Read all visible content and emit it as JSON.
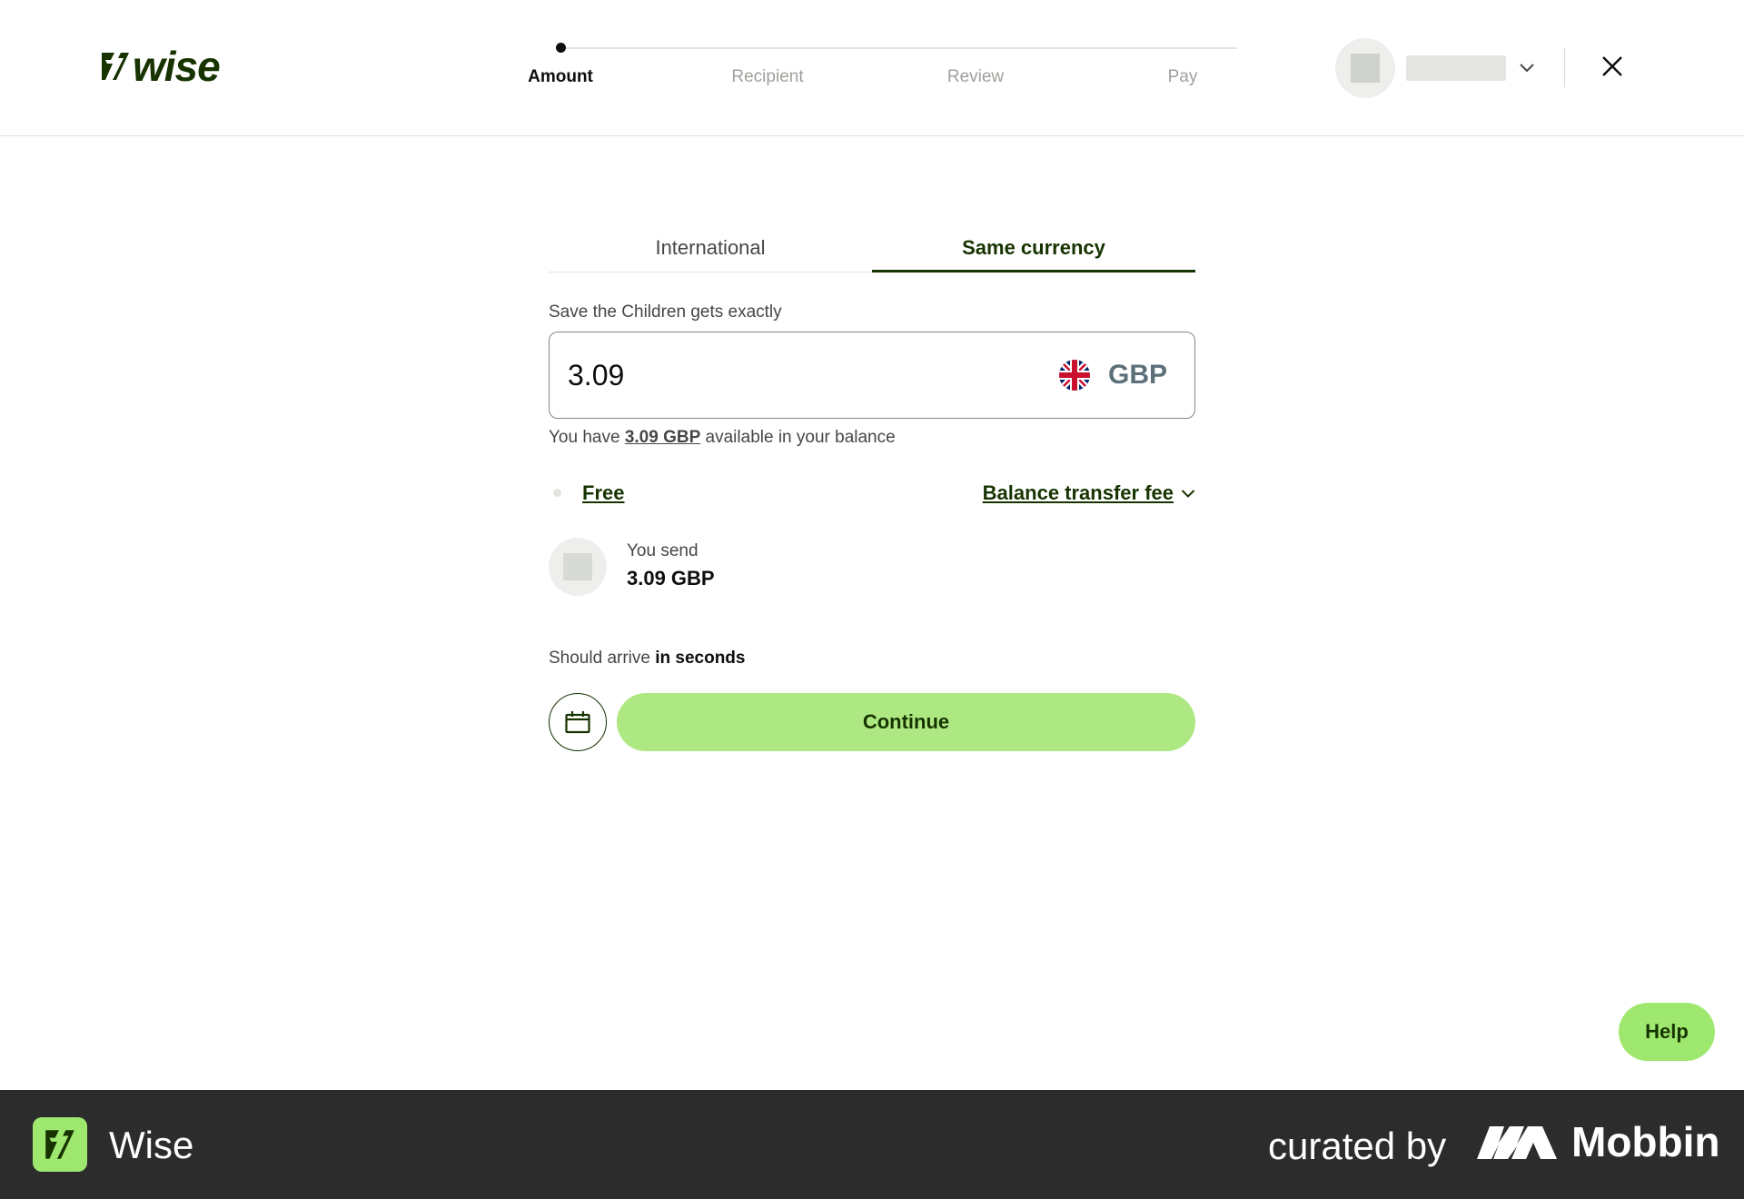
{
  "brand": {
    "name": "wise",
    "color": "#163300",
    "accent": "#9fe870"
  },
  "stepper": {
    "steps": [
      {
        "label": "Amount",
        "active": true
      },
      {
        "label": "Recipient",
        "active": false
      },
      {
        "label": "Review",
        "active": false
      },
      {
        "label": "Pay",
        "active": false
      }
    ]
  },
  "account": {
    "icon": "chevron-down-icon"
  },
  "header": {
    "close_icon": "close-icon"
  },
  "tabs": [
    {
      "label": "International",
      "selected": false
    },
    {
      "label": "Same currency",
      "selected": true
    }
  ],
  "amount": {
    "label": "Save the Children gets exactly",
    "value": "3.09",
    "currency": "GBP",
    "flag_icon": "uk-flag-icon"
  },
  "balance": {
    "prefix": "You have",
    "amount": "3.09 GBP",
    "suffix": "available in your balance"
  },
  "fee": {
    "value": "Free",
    "type_label": "Balance transfer fee"
  },
  "send": {
    "label": "You send",
    "value": "3.09 GBP"
  },
  "arrival": {
    "prefix": "Should arrive",
    "strong": "in seconds"
  },
  "actions": {
    "schedule_icon": "calendar-icon",
    "continue_label": "Continue",
    "continue_color": "#aee882"
  },
  "help": {
    "label": "Help"
  },
  "footer": {
    "app_name": "Wise",
    "curated_by": "curated by",
    "brand_name": "Mobbin"
  }
}
